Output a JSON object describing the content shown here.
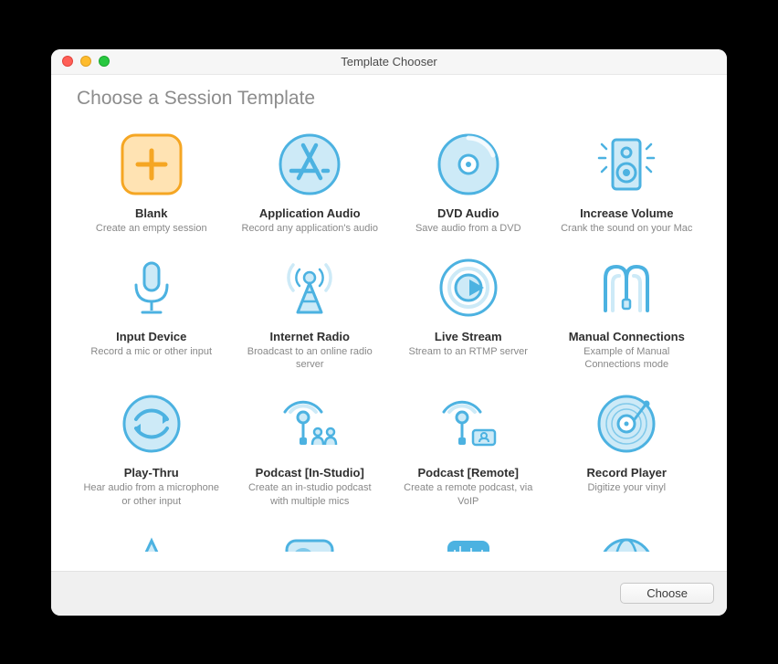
{
  "window": {
    "title": "Template Chooser"
  },
  "header": {
    "title": "Choose a Session Template"
  },
  "templates": [
    {
      "title": "Blank",
      "desc": "Create an empty session"
    },
    {
      "title": "Application Audio",
      "desc": "Record any application's audio"
    },
    {
      "title": "DVD Audio",
      "desc": "Save audio from a DVD"
    },
    {
      "title": "Increase Volume",
      "desc": "Crank the sound on your Mac"
    },
    {
      "title": "Input Device",
      "desc": "Record a mic or other input"
    },
    {
      "title": "Internet Radio",
      "desc": "Broadcast to an online radio server"
    },
    {
      "title": "Live Stream",
      "desc": "Stream to an RTMP server"
    },
    {
      "title": "Manual Connections",
      "desc": "Example of Manual Connections mode"
    },
    {
      "title": "Play-Thru",
      "desc": "Hear audio from a microphone or other input"
    },
    {
      "title": "Podcast [In-Studio]",
      "desc": "Create an in-studio podcast with multiple mics"
    },
    {
      "title": "Podcast [Remote]",
      "desc": "Create a remote podcast, via VoIP"
    },
    {
      "title": "Record Player",
      "desc": "Digitize your vinyl"
    }
  ],
  "footer": {
    "choose_label": "Choose"
  },
  "colors": {
    "accent_blue": "#4cb2e1",
    "accent_fill": "#cdeaf7",
    "blank_orange": "#f5a623",
    "blank_fill": "#ffe3b3"
  }
}
